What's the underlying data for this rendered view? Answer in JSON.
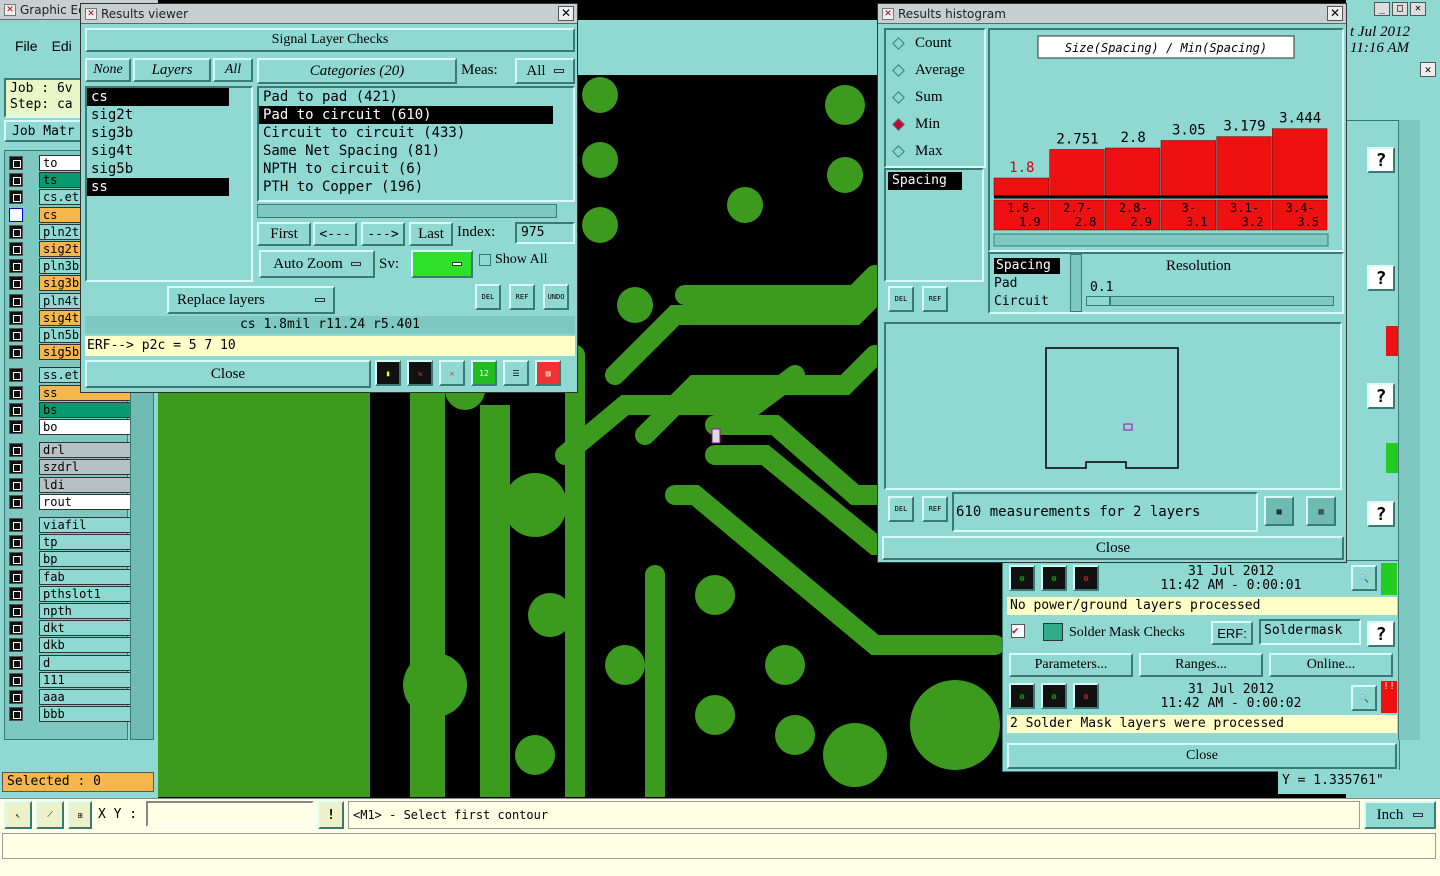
{
  "app": {
    "title": "Graphic Ed",
    "menu": [
      "File",
      "Edi"
    ],
    "job_label": "Job : 6v",
    "step_label": "Step: ca",
    "job_matrix": "Job Matr",
    "date_top": "t Jul 2012",
    "time_top": "11:16 AM"
  },
  "layers": [
    {
      "name": "to",
      "color": "wht"
    },
    {
      "name": "ts",
      "color": "grn"
    },
    {
      "name": "cs.et",
      "color": "tealbox"
    },
    {
      "name": "cs",
      "color": "orng",
      "checked": true
    },
    {
      "name": "pln2t",
      "color": "tealbox"
    },
    {
      "name": "sig2t",
      "color": "orng"
    },
    {
      "name": "pln3b",
      "color": "tealbox"
    },
    {
      "name": "sig3b",
      "color": "orng"
    },
    {
      "name": "pln4t",
      "color": "tealbox"
    },
    {
      "name": "sig4t",
      "color": "orng"
    },
    {
      "name": "pln5b",
      "color": "tealbox"
    },
    {
      "name": "sig5b",
      "color": "orng"
    },
    {
      "name": "ss.etch",
      "color": "tealbox"
    },
    {
      "name": "ss",
      "color": "orng"
    },
    {
      "name": "bs",
      "color": "grn"
    },
    {
      "name": "bo",
      "color": "wht"
    },
    {
      "name": "drl",
      "color": "gray"
    },
    {
      "name": "szdrl",
      "color": "gray"
    },
    {
      "name": "ldi",
      "color": "gray"
    },
    {
      "name": "rout",
      "color": "wht"
    },
    {
      "name": "viafil",
      "color": "tealbox"
    },
    {
      "name": "tp",
      "color": "tealbox"
    },
    {
      "name": "bp",
      "color": "tealbox"
    },
    {
      "name": "fab",
      "color": "tealbox"
    },
    {
      "name": "pthslot1",
      "color": "tealbox"
    },
    {
      "name": "npth",
      "color": "tealbox"
    },
    {
      "name": "dkt",
      "color": "tealbox"
    },
    {
      "name": "dkb",
      "color": "tealbox"
    },
    {
      "name": "d",
      "color": "tealbox"
    },
    {
      "name": "111",
      "color": "tealbox"
    },
    {
      "name": "aaa",
      "color": "tealbox"
    },
    {
      "name": "bbb",
      "color": "tealbox"
    }
  ],
  "status": {
    "selected": "Selected : 0",
    "xy_label": "X Y :",
    "xy_value": "",
    "hint": "<M1> - Select first contour",
    "units": "Inch",
    "y_readout": "Y = 1.335761\""
  },
  "results_viewer": {
    "title": "Results viewer",
    "header": "Signal Layer Checks",
    "none": "None",
    "layers_tab": "Layers",
    "all": "All",
    "layer_list": [
      "cs",
      "sig2t",
      "sig3b",
      "sig4t",
      "sig5b",
      "ss"
    ],
    "categories_label": "Categories (20)",
    "meas_label": "Meas:",
    "meas_value": "All",
    "categories": [
      "Pad to pad (421)",
      "Pad to circuit (610)",
      "Circuit to circuit (433)",
      "Same Net Spacing (81)",
      "NPTH to circuit (6)",
      "PTH to Copper (196)"
    ],
    "first": "First",
    "prev": "<---",
    "next": "--->",
    "last": "Last",
    "index_label": "Index:",
    "index_value": "975",
    "auto_zoom": "Auto Zoom",
    "sv_label": "Sv:",
    "show_all": "Show All",
    "replace_layers": "Replace layers",
    "del": "DEL",
    "ref": "REF",
    "undo": "UNDO",
    "info": "cs 1.8mil  r11.24  r5.401",
    "erf_line": "ERF--> p2c = 5 7 10",
    "close": "Close"
  },
  "histogram": {
    "title": "Results histogram",
    "modes": [
      "Count",
      "Average",
      "Sum",
      "Min",
      "Max"
    ],
    "selected_mode": "Min",
    "plot_title": "Size(Spacing) / Min(Spacing)",
    "spacing_item": "Spacing",
    "resolution_label": "Resolution",
    "resolution_value": "0.1",
    "sort_items": [
      "Spacing",
      "Pad",
      "Circuit"
    ],
    "summary": "610 measurements for 2 layers",
    "close": "Close"
  },
  "chart_data": {
    "type": "bar",
    "title": "Size(Spacing) / Min(Spacing)",
    "categories": [
      "1.8-1.9",
      "2.7-2.8",
      "2.8-2.9",
      "3-3.1",
      "3.1-3.2",
      "3.4-3.5"
    ],
    "values": [
      1.8,
      2.751,
      2.8,
      3.05,
      3.179,
      3.444
    ],
    "value_labels": [
      "1.8",
      "2.751",
      "2.8",
      "3.05",
      "3.179",
      "3.444"
    ],
    "bar_color": "#ee1111"
  },
  "checklist": {
    "ts1": "31 Jul 2012",
    "ts1b": "11:42 AM - 0:00:01",
    "msg1": "No power/ground layers processed",
    "sm_name": "Solder Mask Checks",
    "erf_label": "ERF:",
    "erf_value": "Soldermask",
    "params": "Parameters...",
    "ranges": "Ranges...",
    "online": "Online...",
    "ts2": "31 Jul 2012",
    "ts2b": "11:42 AM - 0:00:02",
    "msg2": "2 Solder Mask layers were processed",
    "close": "Close"
  }
}
